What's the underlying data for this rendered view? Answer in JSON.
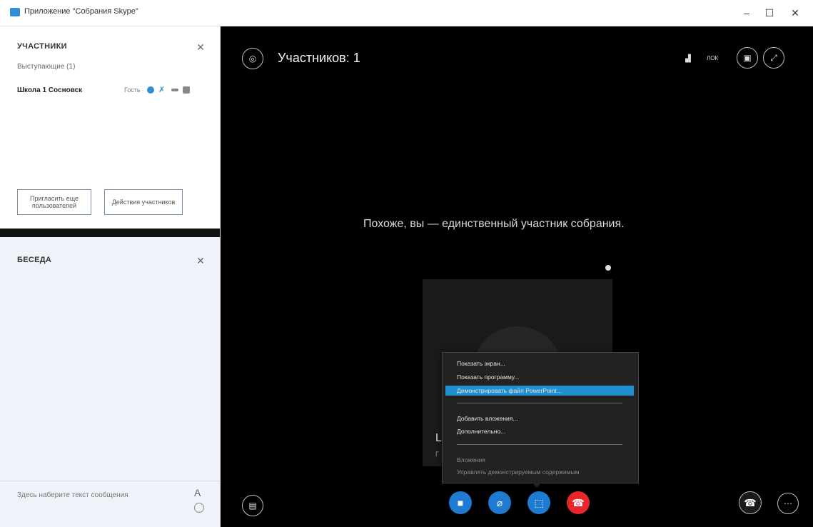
{
  "window": {
    "title": "Приложение \"Собрания Skype\"",
    "controls": [
      "–",
      "☐",
      "✕"
    ]
  },
  "participants_panel": {
    "title": "УЧАСТНИКИ",
    "section": "Выступающие (1)",
    "participant": {
      "name": "Школа 1 Сосновск",
      "role": "Гость"
    },
    "buttons": {
      "invite": "Пригласить еще пользователей",
      "actions": "Действия участников"
    }
  },
  "conversation_panel": {
    "title": "БЕСЕДА",
    "input_placeholder": "Здесь наберите текст сообщения",
    "font_button": "A"
  },
  "stage": {
    "participants_count": "Участников: 1",
    "quality_label": "ЛОК",
    "alone_message": "Похоже, вы — единственный участник собрания.",
    "tile_initial": "L",
    "tile_sub": "Г"
  },
  "share_menu": {
    "items": [
      {
        "label": "Показать экран..."
      },
      {
        "label": "Показать программу..."
      },
      {
        "label": "Демонстрировать файл PowerPoint..."
      },
      {
        "label": "Добавить вложения..."
      },
      {
        "label": "Дополнительно..."
      },
      {
        "label": "Вложения"
      },
      {
        "label": "Управлять демонстрируемым содержимым"
      }
    ]
  },
  "toolbar": {
    "video_color": "#1f7bd1",
    "mic_color": "#1f7bd1",
    "share_color": "#1f7bd1",
    "hangup_color": "#e8262b"
  }
}
